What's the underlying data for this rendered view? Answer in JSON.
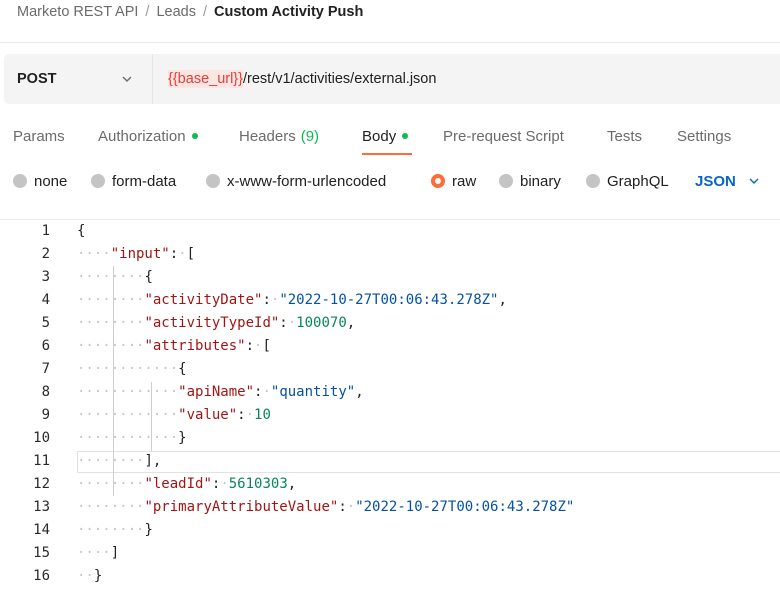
{
  "breadcrumb": {
    "items": [
      "Marketo REST API",
      "Leads"
    ],
    "separator": "/",
    "current": "Custom Activity Push"
  },
  "request": {
    "method": "POST",
    "url_variable": "{{base_url}}",
    "url_path": "/rest/v1/activities/external.json"
  },
  "tabs": [
    {
      "label": "Params"
    },
    {
      "label": "Authorization"
    },
    {
      "label": "Headers",
      "count": "(9)"
    },
    {
      "label": "Body"
    },
    {
      "label": "Pre-request Script"
    },
    {
      "label": "Tests"
    },
    {
      "label": "Settings"
    }
  ],
  "active_tab": "Body",
  "body_types": [
    "none",
    "form-data",
    "x-www-form-urlencoded",
    "raw",
    "binary",
    "GraphQL"
  ],
  "selected_body_type": "raw",
  "language": "JSON",
  "editor": {
    "line_numbers": [
      "1",
      "2",
      "3",
      "4",
      "5",
      "6",
      "7",
      "8",
      "9",
      "10",
      "11",
      "12",
      "13",
      "14",
      "15",
      "16"
    ],
    "lines": [
      [
        {
          "t": "p",
          "v": "{"
        }
      ],
      [
        {
          "t": "w",
          "v": "····"
        },
        {
          "t": "k",
          "v": "\"input\""
        },
        {
          "t": "p",
          "v": ":"
        },
        {
          "t": "w",
          "v": "·"
        },
        {
          "t": "p",
          "v": "["
        }
      ],
      [
        {
          "t": "w",
          "v": "········"
        },
        {
          "t": "p",
          "v": "{"
        }
      ],
      [
        {
          "t": "w",
          "v": "········"
        },
        {
          "t": "k",
          "v": "\"activityDate\""
        },
        {
          "t": "p",
          "v": ":"
        },
        {
          "t": "w",
          "v": "·"
        },
        {
          "t": "s",
          "v": "\"2022-10-27T00:06:43.278Z\""
        },
        {
          "t": "p",
          "v": ","
        }
      ],
      [
        {
          "t": "w",
          "v": "········"
        },
        {
          "t": "k",
          "v": "\"activityTypeId\""
        },
        {
          "t": "p",
          "v": ":"
        },
        {
          "t": "w",
          "v": "·"
        },
        {
          "t": "n",
          "v": "100070"
        },
        {
          "t": "p",
          "v": ","
        }
      ],
      [
        {
          "t": "w",
          "v": "········"
        },
        {
          "t": "k",
          "v": "\"attributes\""
        },
        {
          "t": "p",
          "v": ":"
        },
        {
          "t": "w",
          "v": "·"
        },
        {
          "t": "p",
          "v": "["
        }
      ],
      [
        {
          "t": "w",
          "v": "············"
        },
        {
          "t": "p",
          "v": "{"
        }
      ],
      [
        {
          "t": "w",
          "v": "············"
        },
        {
          "t": "k",
          "v": "\"apiName\""
        },
        {
          "t": "p",
          "v": ":"
        },
        {
          "t": "w",
          "v": "·"
        },
        {
          "t": "s",
          "v": "\"quantity\""
        },
        {
          "t": "p",
          "v": ","
        }
      ],
      [
        {
          "t": "w",
          "v": "············"
        },
        {
          "t": "k",
          "v": "\"value\""
        },
        {
          "t": "p",
          "v": ":"
        },
        {
          "t": "w",
          "v": "·"
        },
        {
          "t": "n",
          "v": "10"
        }
      ],
      [
        {
          "t": "w",
          "v": "············"
        },
        {
          "t": "p",
          "v": "}"
        }
      ],
      [
        {
          "t": "w",
          "v": "········"
        },
        {
          "t": "p",
          "v": "],"
        }
      ],
      [
        {
          "t": "w",
          "v": "········"
        },
        {
          "t": "k",
          "v": "\"leadId\""
        },
        {
          "t": "p",
          "v": ":"
        },
        {
          "t": "w",
          "v": "·"
        },
        {
          "t": "n",
          "v": "5610303"
        },
        {
          "t": "p",
          "v": ","
        }
      ],
      [
        {
          "t": "w",
          "v": "········"
        },
        {
          "t": "k",
          "v": "\"primaryAttributeValue\""
        },
        {
          "t": "p",
          "v": ":"
        },
        {
          "t": "w",
          "v": "·"
        },
        {
          "t": "s",
          "v": "\"2022-10-27T00:06:43.278Z\""
        }
      ],
      [
        {
          "t": "w",
          "v": "········"
        },
        {
          "t": "p",
          "v": "}"
        }
      ],
      [
        {
          "t": "w",
          "v": "····"
        },
        {
          "t": "p",
          "v": "]"
        }
      ],
      [
        {
          "t": "w",
          "v": "··"
        },
        {
          "t": "p",
          "v": "}"
        }
      ]
    ],
    "highlighted_line": 11
  },
  "colors": {
    "accent": "#ff6c37",
    "status_green": "#0cbb52",
    "json_key": "#a31515",
    "json_string": "#0451a5",
    "json_number": "#098658",
    "variable": "#e0413a"
  }
}
